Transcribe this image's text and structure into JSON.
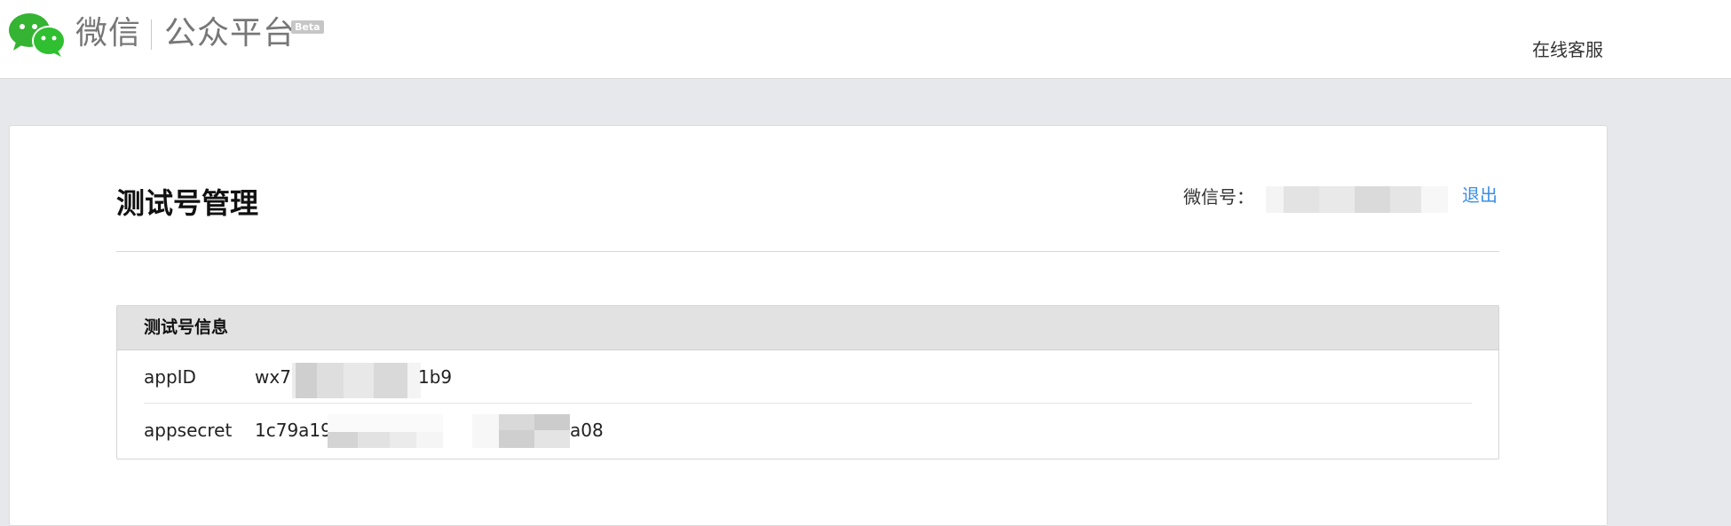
{
  "header": {
    "brand_wx": "微信",
    "brand_mp": "公众平台",
    "beta": "Beta",
    "online_service": "在线客服"
  },
  "page": {
    "title": "测试号管理",
    "wxid_label": "微信号：",
    "logout": "退出"
  },
  "panel": {
    "title": "测试号信息",
    "rows": [
      {
        "key": "appID",
        "value_visible_prefix": "wx7",
        "value_visible_suffix": "1b9"
      },
      {
        "key": "appsecret",
        "value_visible_prefix": "1c79a19",
        "value_visible_suffix": "a08"
      }
    ]
  },
  "colors": {
    "background": "#e7e8eb",
    "link": "#3a8ee6",
    "wechat_green": "#2dc100",
    "panel_header": "#e2e2e2"
  },
  "icons": {
    "logo": "wechat-logo-icon"
  }
}
